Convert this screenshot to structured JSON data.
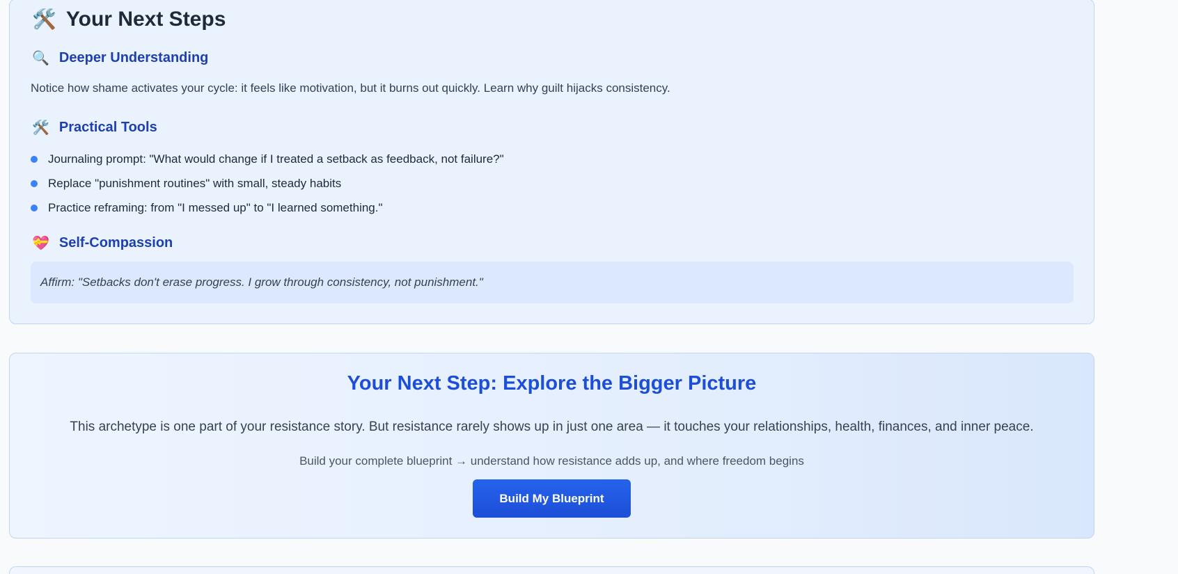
{
  "next_steps": {
    "title": "Your Next Steps",
    "title_icon": "hammer-and-wrench-icon",
    "deeper": {
      "icon": "magnifying-glass-icon",
      "heading": "Deeper Understanding",
      "text": "Notice how shame activates your cycle: it feels like motivation, but it burns out quickly. Learn why guilt hijacks consistency."
    },
    "tools": {
      "icon": "hammer-and-wrench-icon",
      "heading": "Practical Tools",
      "items": [
        "Journaling prompt: \"What would change if I treated a setback as feedback, not failure?\"",
        "Replace \"punishment routines\" with small, steady habits",
        "Practice reframing: from \"I messed up\" to \"I learned something.\""
      ]
    },
    "compassion": {
      "icon": "heart-with-ribbon-icon",
      "heading": "Self-Compassion",
      "affirmation": "Affirm: \"Setbacks don't erase progress. I grow through consistency, not punishment.\""
    }
  },
  "cta": {
    "title": "Your Next Step: Explore the Bigger Picture",
    "body": "This archetype is one part of your resistance story. But resistance rarely shows up in just one area — it touches your relationships, health, finances, and inner peace.",
    "subtext": "Build your complete blueprint → understand how resistance adds up, and where freedom begins",
    "button_label": "Build My Blueprint"
  },
  "colors": {
    "accent": "#1d4ed8",
    "heading_blue": "#1e40af",
    "bullet": "#3b82f6",
    "card_bg": "#eaf2fe",
    "card_border": "#bfd5f5"
  }
}
